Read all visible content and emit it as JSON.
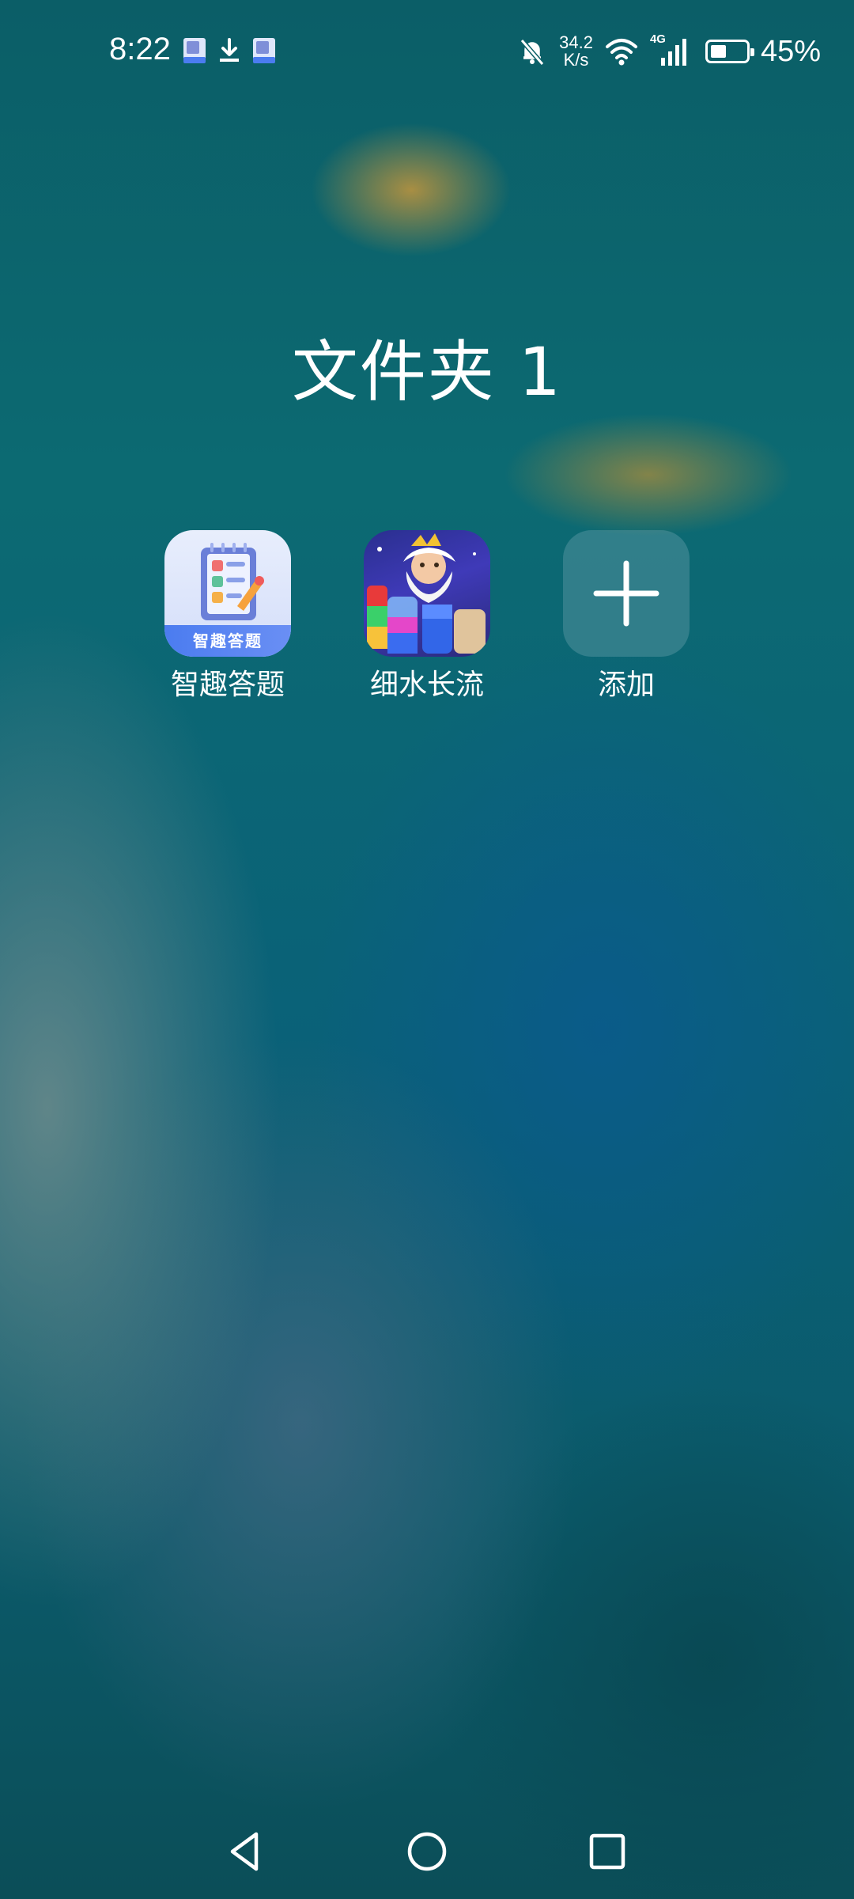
{
  "status_bar": {
    "time": "8:22",
    "net_speed_value": "34.2",
    "net_speed_unit": "K/s",
    "network_type": "4G",
    "battery_percent": "45%",
    "battery_level": 0.45
  },
  "folder": {
    "title": "文件夹 1",
    "apps": [
      {
        "label": "智趣答题",
        "icon": "quiz-app-icon",
        "icon_text": "智趣答题"
      },
      {
        "label": "细水长流",
        "icon": "water-sort-game-icon"
      },
      {
        "label": "添加",
        "icon": "plus-icon"
      }
    ]
  },
  "navigation": {
    "back": "back-triangle-icon",
    "home": "home-circle-icon",
    "recents": "recents-square-icon"
  }
}
